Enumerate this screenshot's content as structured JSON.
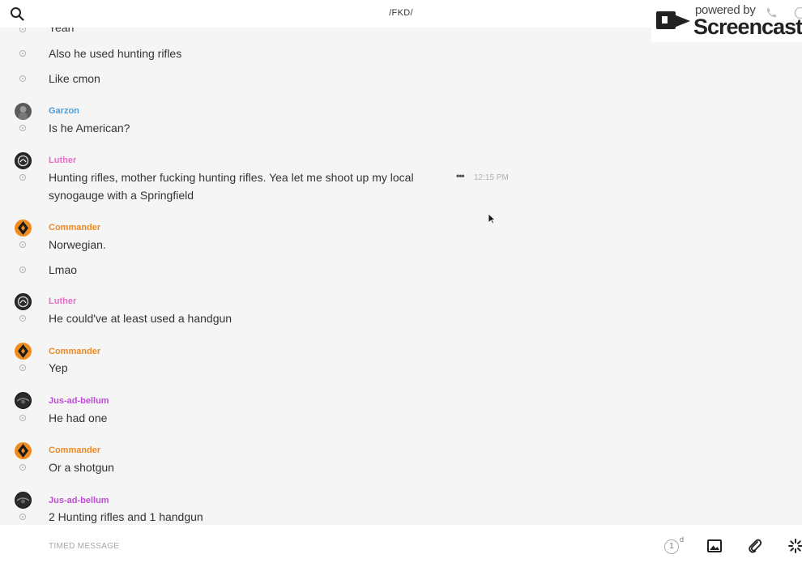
{
  "header": {
    "title": "/FKD/",
    "search_icon": "search-icon"
  },
  "watermark": {
    "small": "powered by",
    "big": "Screencastify"
  },
  "colors": {
    "garzon": "#4a9fd1",
    "luther": "#e36fc6",
    "commander": "#ef8a21",
    "jus": "#c04bd8"
  },
  "messages": [
    {
      "type": "msg",
      "text": "Yeah"
    },
    {
      "type": "msg",
      "text": "Also he used hunting rifles"
    },
    {
      "type": "msg",
      "text": "Like cmon"
    },
    {
      "type": "sender",
      "name": "Garzon",
      "avatar": "garzon-avatar"
    },
    {
      "type": "msg",
      "text": "Is he American?"
    },
    {
      "type": "sender",
      "name": "Luther",
      "avatar": "luther-avatar"
    },
    {
      "type": "msg",
      "text": "Hunting rifles, mother fucking hunting rifles. Yea let me shoot up my local synogauge with a Springfield",
      "time": "12:15 PM"
    },
    {
      "type": "sender",
      "name": "Commander",
      "avatar": "commander-avatar"
    },
    {
      "type": "msg",
      "text": "Norwegian."
    },
    {
      "type": "msg",
      "text": "Lmao"
    },
    {
      "type": "sender",
      "name": "Luther",
      "avatar": "luther-avatar"
    },
    {
      "type": "msg",
      "text": "He could've at least used a handgun"
    },
    {
      "type": "sender",
      "name": "Commander",
      "avatar": "commander-avatar"
    },
    {
      "type": "msg",
      "text": "Yep"
    },
    {
      "type": "sender",
      "name": "Jus-ad-bellum",
      "avatar": "jus-avatar"
    },
    {
      "type": "msg",
      "text": "He had one"
    },
    {
      "type": "sender",
      "name": "Commander",
      "avatar": "commander-avatar"
    },
    {
      "type": "msg",
      "text": "Or a shotgun"
    },
    {
      "type": "sender",
      "name": "Jus-ad-bellum",
      "avatar": "jus-avatar"
    },
    {
      "type": "msg",
      "text": "2 Hunting rifles and 1 handgun"
    }
  ],
  "composer": {
    "placeholder": "TIMED MESSAGE",
    "timer_value": "1",
    "timer_unit": "d",
    "icons": [
      "image-icon",
      "paperclip-icon",
      "spinner-icon"
    ]
  }
}
